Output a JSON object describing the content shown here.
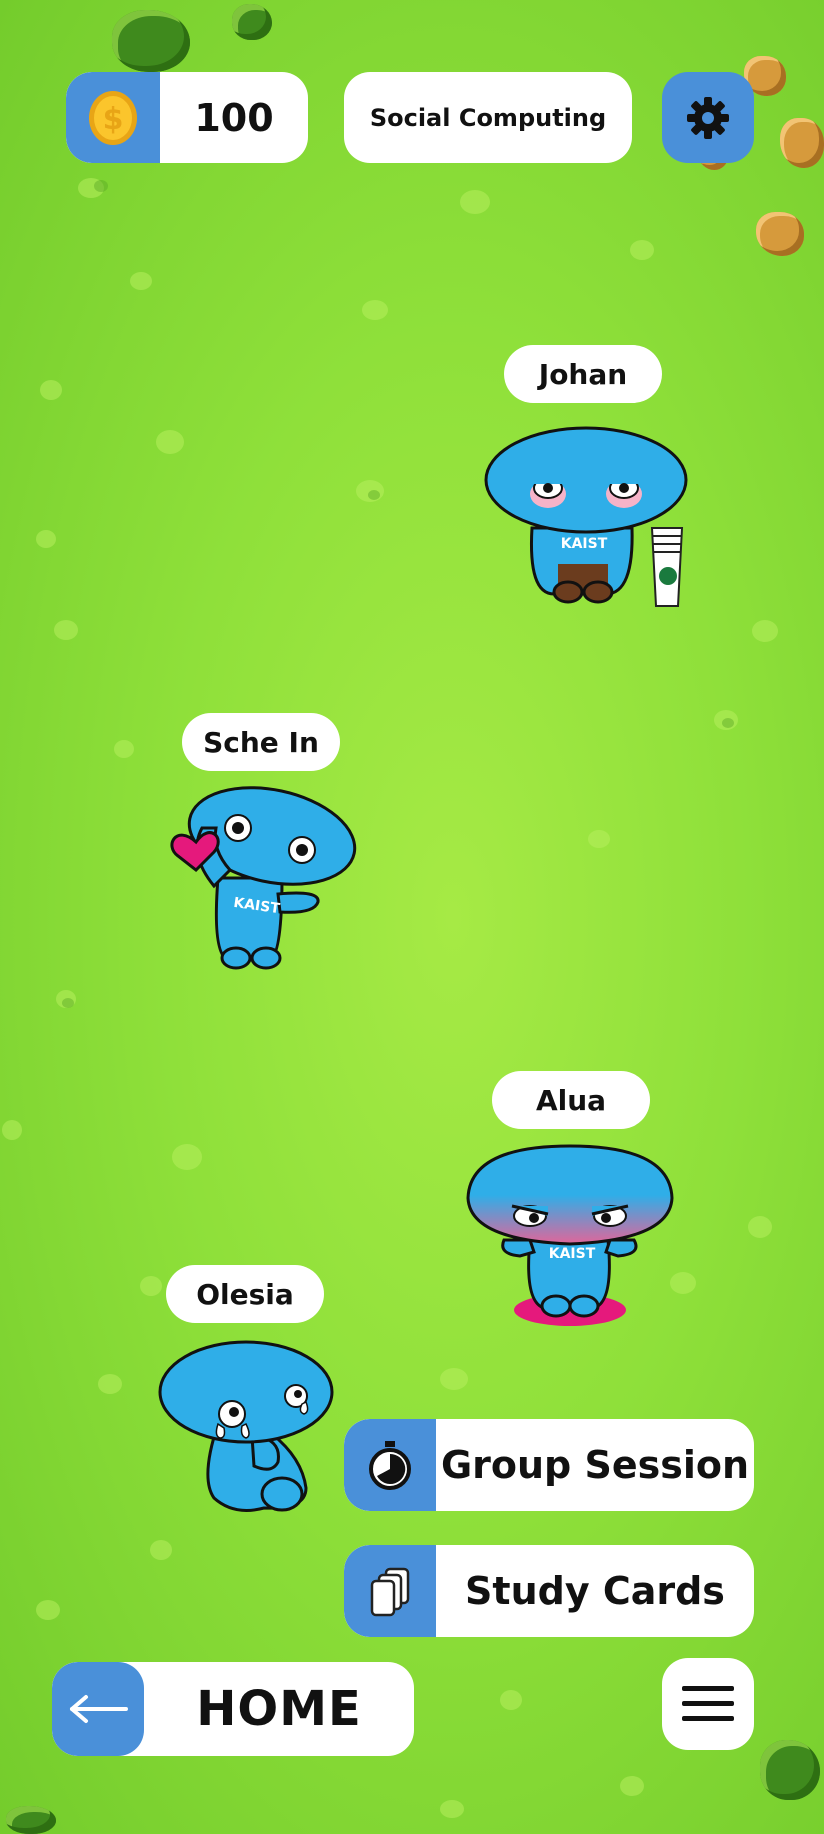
{
  "header": {
    "coins": "100",
    "course_title": "Social Computing",
    "coin_icon": "coin-icon",
    "settings_icon": "gear-icon"
  },
  "characters": [
    {
      "name": "Johan",
      "mood": "sleepy-with-coffee-cups"
    },
    {
      "name": "Sche In",
      "mood": "happy-with-heart"
    },
    {
      "name": "Alua",
      "mood": "angry"
    },
    {
      "name": "Olesia",
      "mood": "crying"
    }
  ],
  "actions": {
    "group_session": {
      "label": "Group Session",
      "icon": "stopwatch-icon"
    },
    "study_cards": {
      "label": "Study Cards",
      "icon": "cards-icon"
    }
  },
  "footer": {
    "home_label": "HOME",
    "back_icon": "arrow-left-icon",
    "menu_icon": "hamburger-menu-icon"
  },
  "colors": {
    "accent_blue": "#4a90d9",
    "character_blue": "#2faee8",
    "grass": "#8fe03a"
  }
}
